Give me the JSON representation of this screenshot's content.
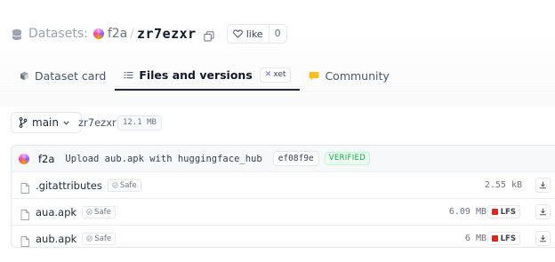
{
  "header": {
    "section_label": "Datasets:",
    "owner": "f2a",
    "separator": "/",
    "repo_name": "zr7ezxr",
    "like_label": "like",
    "like_count": "0",
    "icons": [
      "database-icon",
      "owner-avatar",
      "copy-icon",
      "heart-icon"
    ]
  },
  "tabs": [
    {
      "label": "Dataset card",
      "icon": "dataset-card-icon",
      "active": false
    },
    {
      "label": "Files and versions",
      "icon": "files-icon",
      "active": true,
      "badge": "xet"
    },
    {
      "label": "Community",
      "icon": "community-icon",
      "active": false
    }
  ],
  "toolbar": {
    "branch": "main",
    "repo_path": "zr7ezxr",
    "repo_size": "12.1 MB"
  },
  "commit": {
    "author": "f2a",
    "message": "Upload aub.apk with huggingface_hub",
    "hash": "ef08f9e",
    "status": "VERIFIED"
  },
  "files": [
    {
      "name": ".gitattributes",
      "safe": "Safe",
      "size": "2.55 kB",
      "lfs": ""
    },
    {
      "name": "aua.apk",
      "safe": "Safe",
      "size": "6.09 MB",
      "lfs": "LFS"
    },
    {
      "name": "aub.apk",
      "safe": "Safe",
      "size": "6 MB",
      "lfs": "LFS"
    }
  ],
  "colors": {
    "accent_dark": "#1f2937",
    "verified_green": "#16a34a",
    "lfs_red": "#dc2626",
    "xet_indigo": "#6366f1",
    "community_yellow": "#fbbf24"
  }
}
